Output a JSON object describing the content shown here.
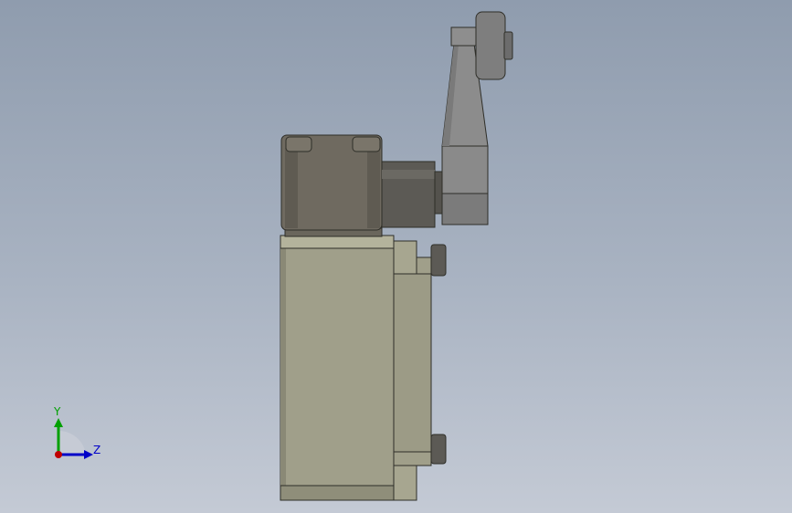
{
  "viewport": {
    "background_top": "#8f9cae",
    "background_bottom": "#c4cad5"
  },
  "model": {
    "body_color": "#a09f8a",
    "head_color": "#6f6a60",
    "shaft_color": "#5c5a55",
    "lever_color": "#8a8a8a",
    "roller_color": "#7e7e7e"
  },
  "triad": {
    "y_label": "Y",
    "z_label": "Z",
    "y_color": "#00a000",
    "z_color": "#0000c8",
    "x_color": "#c00000"
  }
}
